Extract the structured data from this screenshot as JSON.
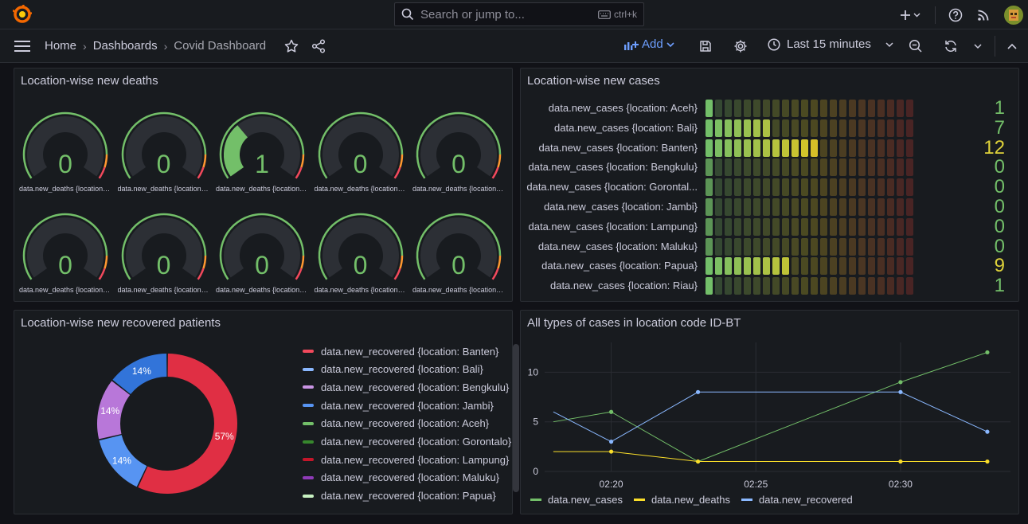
{
  "header": {
    "search_placeholder": "Search or jump to...",
    "search_shortcut": "ctrl+k",
    "icons": [
      "grafana-logo-icon",
      "search-icon",
      "keyboard-icon",
      "plus-icon",
      "help-icon",
      "rss-icon",
      "user-avatar-icon"
    ]
  },
  "nav": {
    "breadcrumbs": [
      "Home",
      "Dashboards",
      "Covid Dashboard"
    ],
    "add_label": "Add",
    "time_range": "Last 15 minutes"
  },
  "panels": {
    "deaths": {
      "title": "Location-wise new deaths",
      "gauges": [
        {
          "value": "0",
          "fraction": 0,
          "label": "data.new_deaths {location: ..."
        },
        {
          "value": "0",
          "fraction": 0,
          "label": "data.new_deaths {location: ..."
        },
        {
          "value": "1",
          "fraction": 0.34,
          "label": "data.new_deaths {location: ..."
        },
        {
          "value": "0",
          "fraction": 0,
          "label": "data.new_deaths {location: ..."
        },
        {
          "value": "0",
          "fraction": 0,
          "label": "data.new_deaths {location: ..."
        },
        {
          "value": "0",
          "fraction": 0,
          "label": "data.new_deaths {location: ..."
        },
        {
          "value": "0",
          "fraction": 0,
          "label": "data.new_deaths {location: ..."
        },
        {
          "value": "0",
          "fraction": 0,
          "label": "data.new_deaths {location: ..."
        },
        {
          "value": "0",
          "fraction": 0,
          "label": "data.new_deaths {location: ..."
        },
        {
          "value": "0",
          "fraction": 0,
          "label": "data.new_deaths {location: ..."
        }
      ]
    },
    "cases": {
      "title": "Location-wise new cases",
      "max_cells": 22,
      "rows": [
        {
          "label": "data.new_cases {location: Aceh}",
          "value": 1,
          "text": "1"
        },
        {
          "label": "data.new_cases {location: Bali}",
          "value": 7,
          "text": "7"
        },
        {
          "label": "data.new_cases {location: Banten}",
          "value": 12,
          "text": "12"
        },
        {
          "label": "data.new_cases {location: Bengkulu}",
          "value": 0,
          "text": "0"
        },
        {
          "label": "data.new_cases {location: Gorontal...",
          "value": 0,
          "text": "0"
        },
        {
          "label": "data.new_cases {location: Jambi}",
          "value": 0,
          "text": "0"
        },
        {
          "label": "data.new_cases {location: Lampung}",
          "value": 0,
          "text": "0"
        },
        {
          "label": "data.new_cases {location: Maluku}",
          "value": 0,
          "text": "0"
        },
        {
          "label": "data.new_cases {location: Papua}",
          "value": 9,
          "text": "9"
        },
        {
          "label": "data.new_cases {location: Riau}",
          "value": 1,
          "text": "1"
        }
      ]
    },
    "recovered": {
      "title": "Location-wise new recovered patients",
      "slices": [
        {
          "label": "57%",
          "value": 57,
          "color": "#e02f44"
        },
        {
          "label": "14%",
          "value": 14.3,
          "color": "#5794f2"
        },
        {
          "label": "14%",
          "value": 14.3,
          "color": "#b877d9"
        },
        {
          "label": "14%",
          "value": 14.4,
          "color": "#3274d9"
        }
      ],
      "legend": [
        {
          "label": "data.new_recovered {location: Banten}",
          "color": "#f2495c"
        },
        {
          "label": "data.new_recovered {location: Bali}",
          "color": "#8ab8ff"
        },
        {
          "label": "data.new_recovered {location: Bengkulu}",
          "color": "#ca95e5"
        },
        {
          "label": "data.new_recovered {location: Jambi}",
          "color": "#5794f2"
        },
        {
          "label": "data.new_recovered {location: Aceh}",
          "color": "#73bf69"
        },
        {
          "label": "data.new_recovered {location: Gorontalo}",
          "color": "#37872d"
        },
        {
          "label": "data.new_recovered {location: Lampung}",
          "color": "#c4162a"
        },
        {
          "label": "data.new_recovered {location: Maluku}",
          "color": "#8f3bb8"
        },
        {
          "label": "data.new_recovered {location: Papua}",
          "color": "#c8f2c2"
        }
      ]
    },
    "timeseries": {
      "title": "All types of cases in location code ID-BT"
    }
  },
  "chart_data": {
    "type": "line",
    "x": [
      "02:18",
      "02:20",
      "02:23",
      "02:30",
      "02:33"
    ],
    "xticks": [
      "02:20",
      "02:25",
      "02:30"
    ],
    "yticks": [
      "0",
      "5",
      "10"
    ],
    "ylim": [
      0,
      13
    ],
    "grid": true,
    "legend_position": "bottom-left",
    "series": [
      {
        "name": "data.new_cases",
        "color": "#73bf69",
        "values": [
          5,
          6,
          1,
          9,
          12
        ]
      },
      {
        "name": "data.new_deaths",
        "color": "#fade2a",
        "values": [
          2,
          2,
          1,
          1,
          1
        ]
      },
      {
        "name": "data.new_recovered",
        "color": "#8ab8ff",
        "values": [
          6,
          3,
          8,
          8,
          4
        ]
      }
    ]
  }
}
